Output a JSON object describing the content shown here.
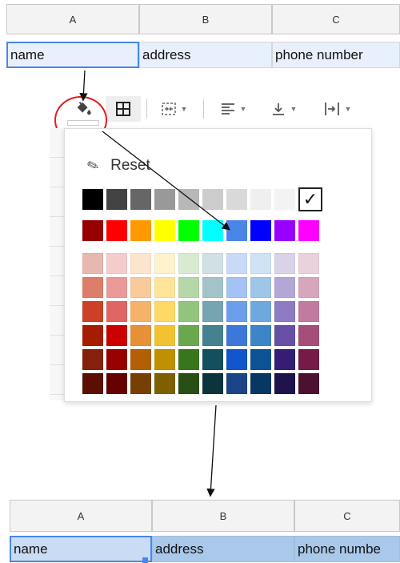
{
  "top_sheet": {
    "columns": [
      "A",
      "B",
      "C"
    ],
    "row": [
      "name",
      "address",
      "phone number"
    ]
  },
  "toolbar": {
    "fill_icon": "paint-bucket-icon",
    "items": [
      "paint-bucket-icon",
      "borders-icon",
      "merge-cells-icon",
      "horizontal-align-icon",
      "vertical-align-icon",
      "text-wrap-icon"
    ]
  },
  "picker": {
    "reset_label": "Reset",
    "check_mark": "✓",
    "gray_row": [
      "#000000",
      "#434343",
      "#666666",
      "#999999",
      "#b7b7b7",
      "#cccccc",
      "#d9d9d9",
      "#efefef",
      "#f3f3f3"
    ],
    "bright_row": [
      "#980000",
      "#ff0000",
      "#ff9900",
      "#ffff00",
      "#00ff00",
      "#00ffff",
      "#4a86e8",
      "#0000ff",
      "#9900ff",
      "#ff00ff"
    ],
    "shade_rows": [
      [
        "#e6b8af",
        "#f4cccc",
        "#fce5cd",
        "#fff2cc",
        "#d9ead3",
        "#d0e0e3",
        "#c9daf8",
        "#cfe2f3",
        "#d9d2e9",
        "#ead1dc"
      ],
      [
        "#dd7e6b",
        "#ea9999",
        "#f9cb9c",
        "#ffe599",
        "#b6d7a8",
        "#a2c4c9",
        "#a4c2f4",
        "#9fc5e8",
        "#b4a7d6",
        "#d5a6bd"
      ],
      [
        "#cc4125",
        "#e06666",
        "#f6b26b",
        "#ffd966",
        "#93c47d",
        "#76a5af",
        "#6d9eeb",
        "#6fa8dc",
        "#8e7cc3",
        "#c27ba0"
      ],
      [
        "#a61c00",
        "#cc0000",
        "#e69138",
        "#f1c232",
        "#6aa84f",
        "#45818e",
        "#3c78d8",
        "#3d85c6",
        "#674ea7",
        "#a64d79"
      ],
      [
        "#85200c",
        "#990000",
        "#b45f06",
        "#bf9000",
        "#38761d",
        "#134f5c",
        "#1155cc",
        "#0b5394",
        "#351c75",
        "#741b47"
      ],
      [
        "#5b0f00",
        "#660000",
        "#783f04",
        "#7f6000",
        "#274e13",
        "#0c343d",
        "#1c4587",
        "#073763",
        "#20124d",
        "#4c1130"
      ]
    ]
  },
  "bottom_sheet": {
    "columns": [
      "A",
      "B",
      "C"
    ],
    "row": [
      "name",
      "address",
      "phone numbe"
    ]
  },
  "colors": {
    "highlight": "#e21c1c",
    "selection": "#4a86e8",
    "filled_cell": "#a9c8ea"
  }
}
